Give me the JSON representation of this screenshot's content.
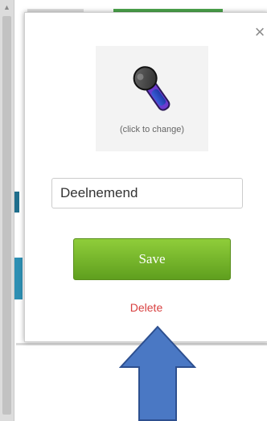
{
  "dialog": {
    "close_glyph": "×",
    "avatar": {
      "icon": "microphone-icon",
      "caption": "(click to change)"
    },
    "name_field": {
      "value": "Deelnemend"
    },
    "save_label": "Save",
    "delete_label": "Delete"
  },
  "colors": {
    "save_button": "#6fb12a",
    "delete_link": "#d84040",
    "arrow": "#4a78c4",
    "page_accent": "#4ca64c"
  }
}
